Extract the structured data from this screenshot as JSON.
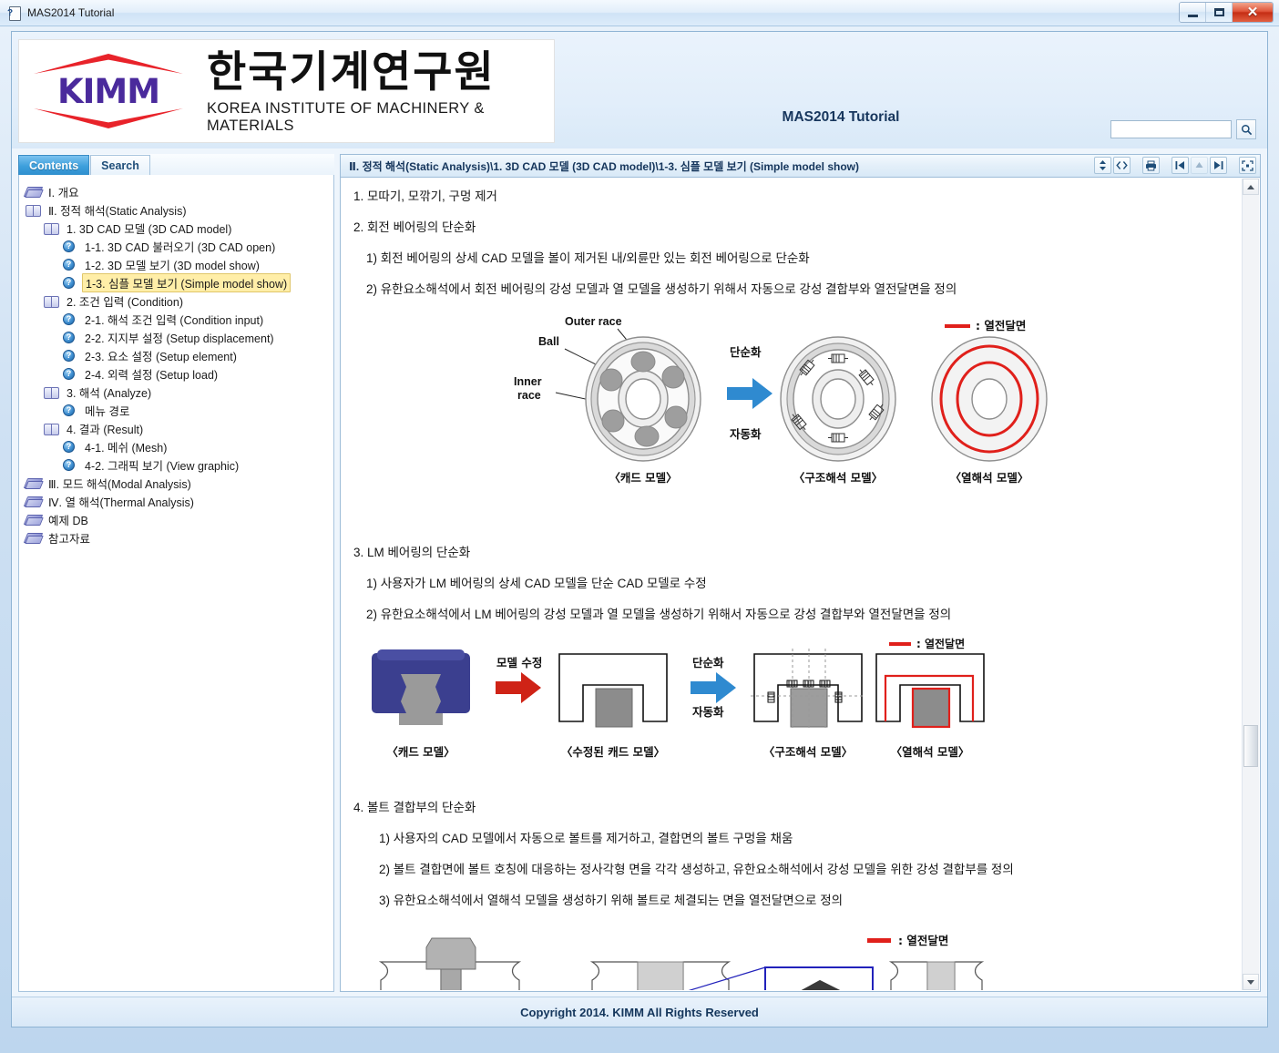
{
  "window": {
    "title": "MAS2014 Tutorial",
    "icon": "help-page-icon",
    "minimize_label": "—",
    "maximize_label": "□",
    "close_label": "✕"
  },
  "header": {
    "logo": {
      "wordmark": "KIMM",
      "korean_name": "한국기계연구원",
      "english_name": "KOREA INSTITUTE OF MACHINERY & MATERIALS"
    },
    "title": "MAS2014 Tutorial",
    "search": {
      "value": "",
      "placeholder": "",
      "button_icon": "search-icon"
    }
  },
  "sidebar": {
    "tabs": [
      {
        "label": "Contents",
        "active": true
      },
      {
        "label": "Search",
        "active": false
      }
    ],
    "tree": [
      {
        "label": "Ⅰ. 개요",
        "icon": "book-icon",
        "depth": 0,
        "selected": false
      },
      {
        "label": "Ⅱ. 정적 해석(Static Analysis)",
        "icon": "open-book-icon",
        "depth": 0,
        "selected": false
      },
      {
        "label": "1. 3D CAD 모델 (3D CAD model)",
        "icon": "open-book-icon",
        "depth": 1,
        "selected": false
      },
      {
        "label": "1-1. 3D CAD 불러오기 (3D CAD open)",
        "icon": "topic-icon",
        "depth": 2,
        "selected": false
      },
      {
        "label": "1-2. 3D 모델 보기 (3D model show)",
        "icon": "topic-icon",
        "depth": 2,
        "selected": false
      },
      {
        "label": "1-3. 심플 모델 보기 (Simple model show)",
        "icon": "topic-icon",
        "depth": 2,
        "selected": true
      },
      {
        "label": "2. 조건 입력 (Condition)",
        "icon": "open-book-icon",
        "depth": 1,
        "selected": false
      },
      {
        "label": "2-1. 해석 조건 입력 (Condition input)",
        "icon": "topic-icon",
        "depth": 2,
        "selected": false
      },
      {
        "label": "2-2. 지지부 설정 (Setup displacement)",
        "icon": "topic-icon",
        "depth": 2,
        "selected": false
      },
      {
        "label": "2-3. 요소 설정 (Setup element)",
        "icon": "topic-icon",
        "depth": 2,
        "selected": false
      },
      {
        "label": "2-4. 외력 설정 (Setup load)",
        "icon": "topic-icon",
        "depth": 2,
        "selected": false
      },
      {
        "label": "3. 해석 (Analyze)",
        "icon": "open-book-icon",
        "depth": 1,
        "selected": false
      },
      {
        "label": "메뉴 경로",
        "icon": "topic-icon",
        "depth": 2,
        "selected": false
      },
      {
        "label": "4. 결과 (Result)",
        "icon": "open-book-icon",
        "depth": 1,
        "selected": false
      },
      {
        "label": "4-1. 메쉬 (Mesh)",
        "icon": "topic-icon",
        "depth": 2,
        "selected": false
      },
      {
        "label": "4-2. 그래픽 보기 (View graphic)",
        "icon": "topic-icon",
        "depth": 2,
        "selected": false
      },
      {
        "label": "Ⅲ. 모드 해석(Modal Analysis)",
        "icon": "book-icon",
        "depth": 0,
        "selected": false
      },
      {
        "label": "Ⅳ. 열 해석(Thermal Analysis)",
        "icon": "book-icon",
        "depth": 0,
        "selected": false
      },
      {
        "label": "예제 DB",
        "icon": "book-icon",
        "depth": 0,
        "selected": false
      },
      {
        "label": "참고자료",
        "icon": "book-icon",
        "depth": 0,
        "selected": false
      }
    ]
  },
  "topic": {
    "breadcrumb": "Ⅱ. 정적 해석(Static Analysis)\\1. 3D CAD 모델 (3D CAD model)\\1-3. 심플 모델 보기 (Simple model show)",
    "toolbar": [
      {
        "icon": "expand-collapse-icon",
        "title": "",
        "disabled": false
      },
      {
        "icon": "code-brackets-icon",
        "title": "",
        "disabled": false
      },
      {
        "icon": "print-icon",
        "title": "",
        "disabled": false
      },
      {
        "icon": "previous-topic-icon",
        "title": "",
        "disabled": false
      },
      {
        "icon": "up-topic-icon",
        "title": "",
        "disabled": true
      },
      {
        "icon": "next-topic-icon",
        "title": "",
        "disabled": false
      },
      {
        "icon": "fullscreen-icon",
        "title": "",
        "disabled": false
      }
    ],
    "paragraphs": [
      {
        "text": "1. 모따기, 모깎기, 구멍 제거",
        "indent": 0
      },
      {
        "text": "2. 회전 베어링의 단순화",
        "indent": 0
      },
      {
        "text": "1) 회전 베어링의 상세 CAD 모델을 볼이 제거된 내/외륜만 있는 회전 베어링으로 단순화",
        "indent": 1
      },
      {
        "text": "2) 유한요소해석에서 회전 베어링의 강성 모델과 열 모델을 생성하기 위해서 자동으로 강성 결합부와 열전달면을 정의",
        "indent": 1
      }
    ],
    "paragraphs2": [
      {
        "text": "3. LM 베어링의 단순화",
        "indent": 0
      },
      {
        "text": "1) 사용자가 LM 베어링의 상세 CAD 모델을 단순 CAD 모델로 수정",
        "indent": 1
      },
      {
        "text": "2) 유한요소해석에서 LM 베어링의 강성 모델과 열 모델을 생성하기 위해서 자동으로 강성 결합부와 열전달면을 정의",
        "indent": 1
      }
    ],
    "paragraphs3": [
      {
        "text": "4. 볼트 결합부의 단순화",
        "indent": 0
      },
      {
        "text": "1) 사용자의 CAD 모델에서 자동으로 볼트를 제거하고, 결합면의 볼트 구멍을 채움",
        "indent": 2
      },
      {
        "text": "2) 볼트 결합면에 볼트 호칭에 대응하는 정사각형 면을 각각 생성하고, 유한요소해석에서 강성 모델을 위한 강성 결합부를 정의",
        "indent": 2
      },
      {
        "text": "3) 유한요소해석에서 열해석 모델을 생성하기 위해 볼트로 체결되는 면을 열전달면으로 정의",
        "indent": 2
      }
    ],
    "figure1": {
      "labels": {
        "outer_race": "Outer race",
        "ball": "Ball",
        "inner_race": "Inner race"
      },
      "arrow_top": "단순화",
      "arrow_bottom": "자동화",
      "legend": ": 열전달면",
      "captions": [
        "〈캐드 모델〉",
        "〈구조해석 모델〉",
        "〈열해석 모델〉"
      ]
    },
    "figure2": {
      "arrow1": "모델 수정",
      "arrow_top": "단순화",
      "arrow_bottom": "자동화",
      "legend": ": 열전달면",
      "captions": [
        "〈캐드 모델〉",
        "〈수정된 캐드 모델〉",
        "〈구조해석 모델〉",
        "〈열해석 모델〉"
      ]
    },
    "figure3": {
      "legend": ": 열전달면"
    }
  },
  "footer": {
    "copyright": "Copyright 2014. KIMM All Rights Reserved"
  },
  "colors": {
    "accent": "#3d9fdc",
    "brand_red": "#e8232a",
    "brand_purple": "#4a2a9c",
    "heat_red": "#e0201b",
    "highlight": "#ffeea8",
    "chrome_blue": "#16365c"
  }
}
